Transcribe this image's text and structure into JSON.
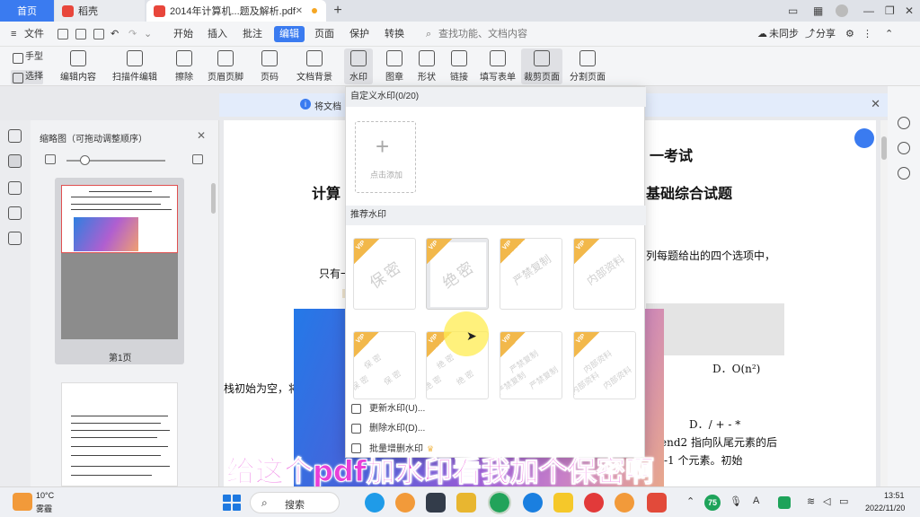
{
  "tabs": {
    "home": "首页",
    "daoke": "稻壳",
    "doc": "2014年计算机...题及解析.pdf",
    "new_tab": "+"
  },
  "menubar": {
    "file": "文件",
    "items": [
      "开始",
      "插入",
      "批注",
      "编辑",
      "页面",
      "保护",
      "转换"
    ],
    "search_placeholder": "查找功能、文档内容",
    "unsynced": "未同步",
    "share": "分享"
  },
  "toolbar": {
    "hand": "手型",
    "select": "选择",
    "edit_content": "编辑内容",
    "edit_scan": "扫描件编辑",
    "erase": "擦除",
    "header_footer": "页眉页脚",
    "page_number": "页码",
    "background": "文档背景",
    "watermark": "水印",
    "stamp": "图章",
    "shape": "形状",
    "link": "链接",
    "fill_form": "填写表单",
    "crop_page": "裁剪页面",
    "split_page": "分割页面"
  },
  "infobar": {
    "text": "将文档"
  },
  "thumbnail_panel": {
    "title": "缩略图（可拖动调整顺序）",
    "page1_label": "第1页"
  },
  "watermark_menu": {
    "custom_header": "自定义水印(0/20)",
    "add_label": "点击添加",
    "recommended_header": "推荐水印",
    "vip_badge": "VIP",
    "presets": [
      "保密",
      "绝密",
      "严禁复制",
      "内部资料"
    ],
    "tiled_presets": [
      "保 密",
      "绝 密",
      "严禁复制",
      "内部资料"
    ],
    "actions": [
      "更新水印(U)...",
      "删除水印(D)...",
      "批量增删水印"
    ]
  },
  "document": {
    "heading1": "一考试",
    "title_left": "计算",
    "title_right": "基础综合试题",
    "line1": "列每题给出的四个选项中，",
    "line2": "只有一",
    "option_d1": "D．O(n²)",
    "line3": "栈初始为空，将",
    "option_d2": "D．/ + - *",
    "line4": "end2 指向队尾元素的后",
    "line5": "-1 个元素。初始"
  },
  "subtitle": "给这个pdf加水印看我加个保密啊",
  "taskbar": {
    "temp": "10°C",
    "weather": "雾霾",
    "search": "搜索",
    "badge": "75",
    "input_method": "A",
    "time": "13:51",
    "date": "2022/11/20"
  },
  "colors": {
    "accent": "#3a7bf0",
    "vip_gold": "#f2b84b",
    "subtitle_magenta": "#e83fd8",
    "active_tab": "#3a7bf0"
  }
}
